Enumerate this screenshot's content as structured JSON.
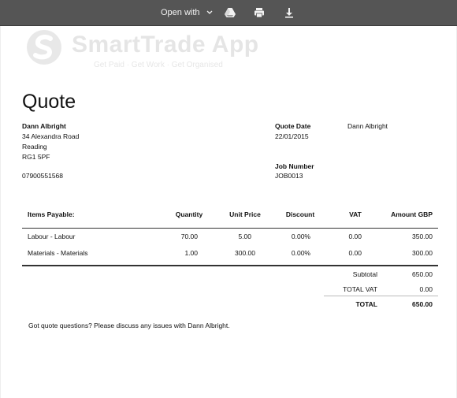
{
  "toolbar": {
    "open_with_label": "Open with",
    "icons": [
      "chevron-down-icon",
      "google-drive-icon",
      "print-icon",
      "download-icon"
    ]
  },
  "watermark": {
    "title": "SmartTrade App",
    "tagline": "Get Paid · Get Work · Get Organised"
  },
  "doc": {
    "title": "Quote",
    "from": {
      "name": "Dann Albright",
      "address_line1": "34 Alexandra Road",
      "address_line2": "Reading",
      "postcode": "RG1 5PF",
      "phone": "07900551568"
    },
    "quote_date_label": "Quote Date",
    "quote_date": "22/01/2015",
    "to_name": "Dann Albright",
    "job_number_label": "Job Number",
    "job_number": "JOB0013",
    "table": {
      "headers": {
        "item": "Items Payable:",
        "qty": "Quantity",
        "unit_price": "Unit Price",
        "discount": "Discount",
        "vat": "VAT",
        "amount": "Amount GBP"
      },
      "rows": [
        {
          "item": "Labour - Labour",
          "qty": "70.00",
          "unit_price": "5.00",
          "discount": "0.00%",
          "vat": "0.00",
          "amount": "350.00"
        },
        {
          "item": "Materials - Materials",
          "qty": "1.00",
          "unit_price": "300.00",
          "discount": "0.00%",
          "vat": "0.00",
          "amount": "300.00"
        }
      ]
    },
    "totals": {
      "subtotal_label": "Subtotal",
      "subtotal": "650.00",
      "total_vat_label": "TOTAL VAT",
      "total_vat": "0.00",
      "total_label": "TOTAL",
      "total": "650.00"
    },
    "footer_note": "Got quote questions? Please discuss any issues with Dann Albright."
  }
}
